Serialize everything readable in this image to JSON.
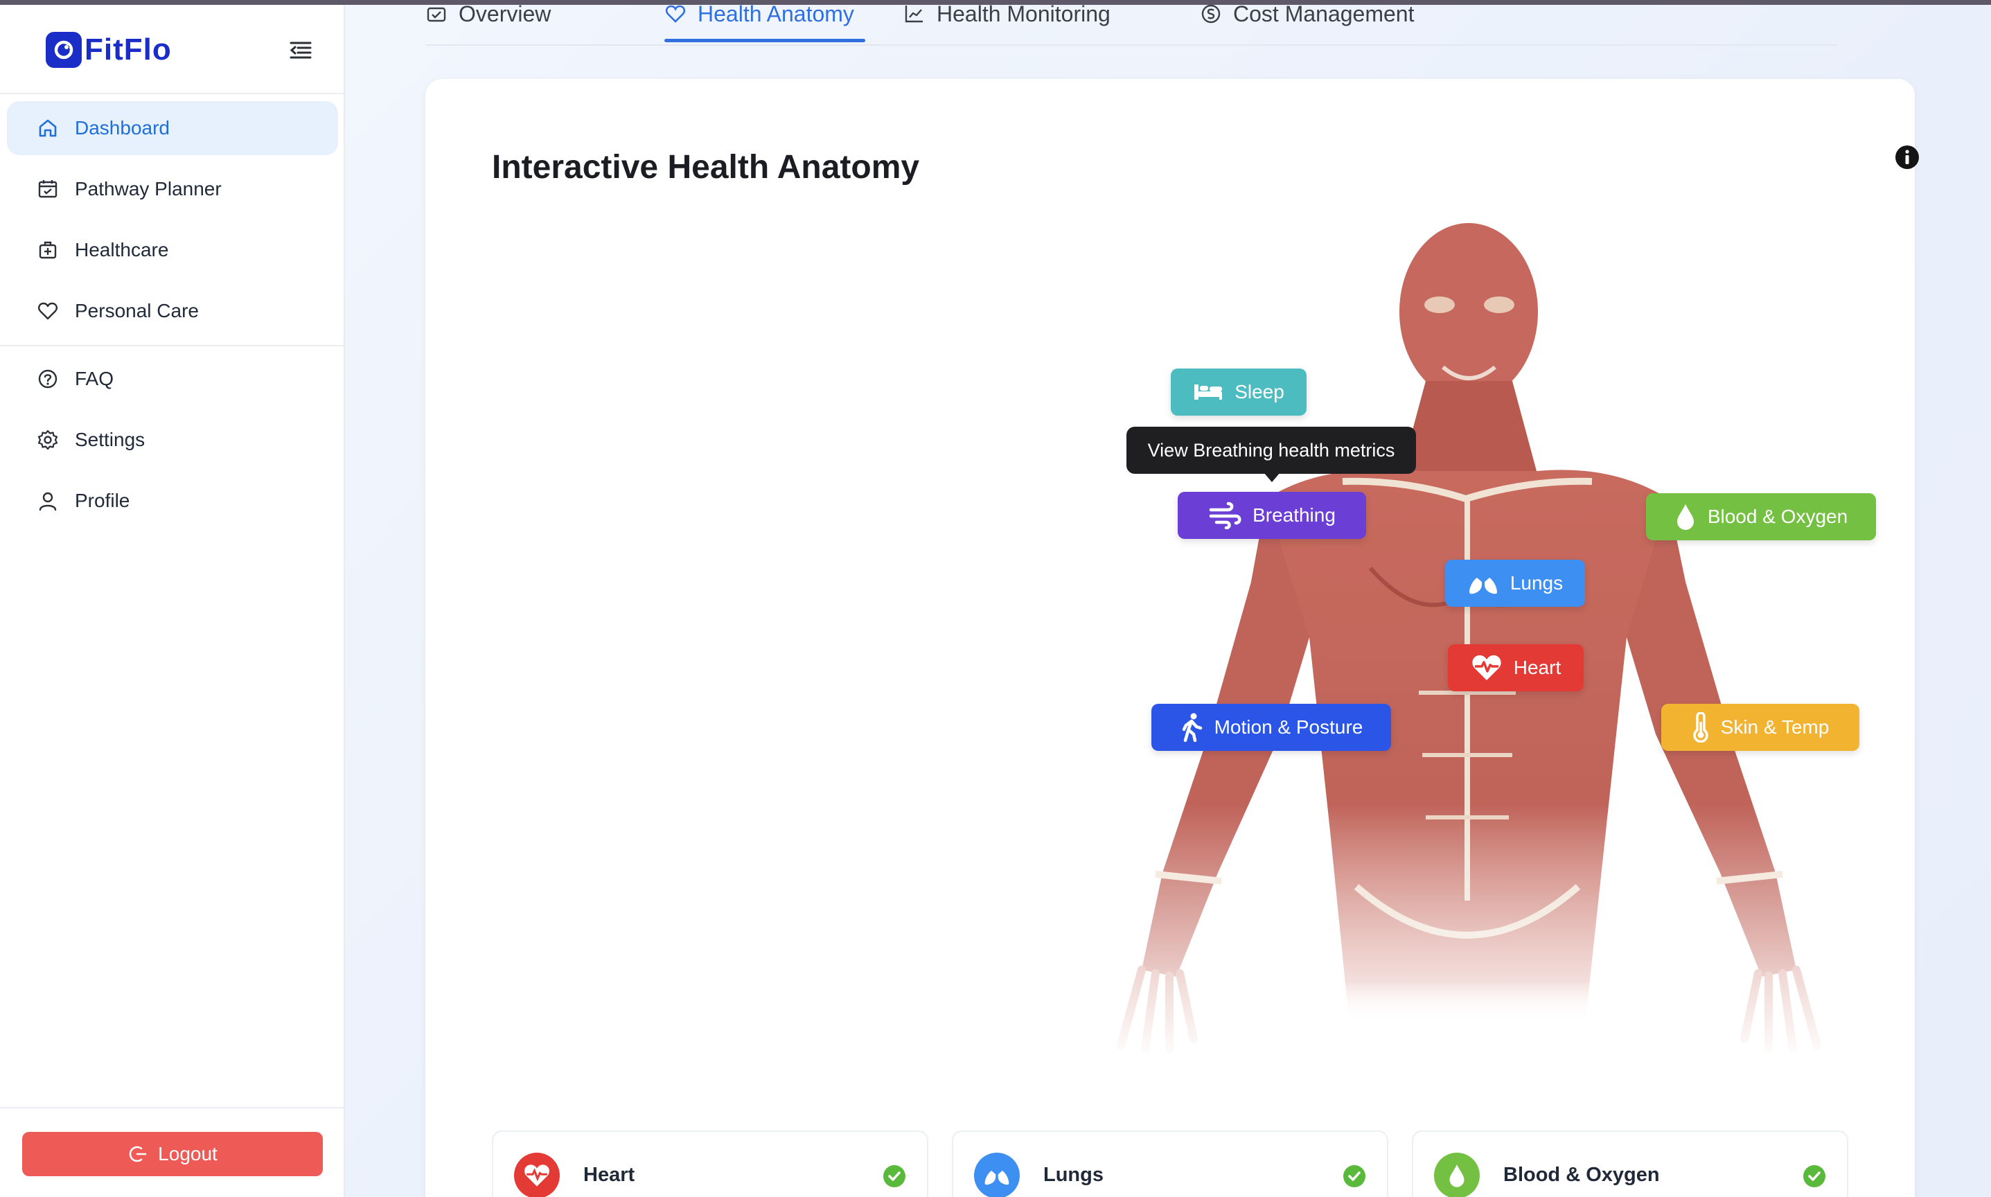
{
  "app": {
    "name": "FitFlo",
    "brand_color": "#1a2ec7"
  },
  "sidebar": {
    "items": [
      {
        "label": "Dashboard",
        "icon": "home-icon",
        "active": true
      },
      {
        "label": "Pathway Planner",
        "icon": "calendar-icon"
      },
      {
        "label": "Healthcare",
        "icon": "medical-bag-icon"
      },
      {
        "label": "Personal Care",
        "icon": "heart-outline-icon"
      },
      {
        "label": "FAQ",
        "icon": "question-circle-icon"
      },
      {
        "label": "Settings",
        "icon": "gear-icon"
      },
      {
        "label": "Profile",
        "icon": "user-icon"
      }
    ],
    "logout_label": "Logout",
    "logout_color": "#ee5a55"
  },
  "tabs": [
    {
      "label": "Overview",
      "icon": "overview-icon"
    },
    {
      "label": "Health Anatomy",
      "icon": "heart-outline-icon",
      "active": true
    },
    {
      "label": "Health Monitoring",
      "icon": "chart-icon"
    },
    {
      "label": "Cost Management",
      "icon": "dollar-circle-icon"
    }
  ],
  "card": {
    "title": "Interactive Health Anatomy",
    "info_icon": "info-icon"
  },
  "tooltip": "View Breathing health metrics",
  "hotspots": {
    "sleep": {
      "label": "Sleep",
      "color": "#4cbcc1",
      "icon": "bed-icon"
    },
    "breathing": {
      "label": "Breathing",
      "color": "#6b3fd6",
      "icon": "wind-icon"
    },
    "blood_oxygen": {
      "label": "Blood & Oxygen",
      "color": "#74c043",
      "icon": "drop-icon"
    },
    "lungs": {
      "label": "Lungs",
      "color": "#3e8ff2",
      "icon": "lungs-icon"
    },
    "heart": {
      "label": "Heart",
      "color": "#e43a36",
      "icon": "heart-pulse-icon"
    },
    "motion": {
      "label": "Motion & Posture",
      "color": "#2b55e6",
      "icon": "walking-icon"
    },
    "skin": {
      "label": "Skin & Temp",
      "color": "#f2b331",
      "icon": "thermometer-icon"
    }
  },
  "metrics": [
    {
      "label": "Heart",
      "icon": "heart-pulse-icon",
      "color": "#e43a36",
      "status_icon": "check-circle-icon"
    },
    {
      "label": "Lungs",
      "icon": "lungs-icon",
      "color": "#3e8ff2",
      "status_icon": "check-circle-icon"
    },
    {
      "label": "Blood & Oxygen",
      "icon": "drop-icon",
      "color": "#74c043",
      "status_icon": "check-circle-icon"
    }
  ]
}
